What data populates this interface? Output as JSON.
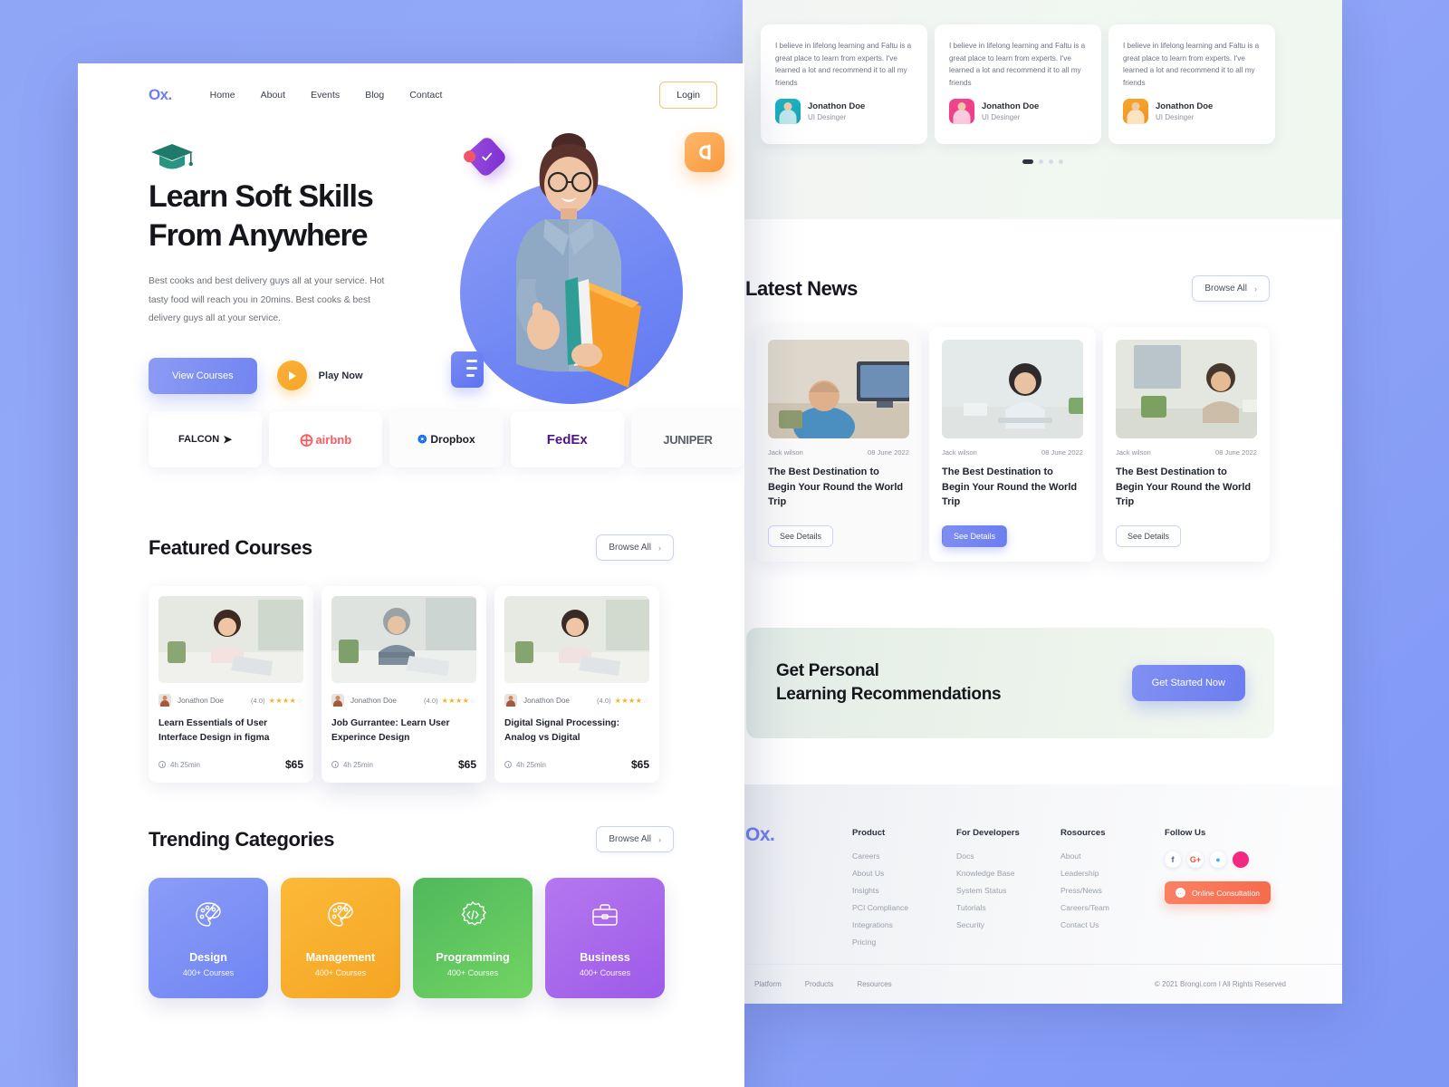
{
  "brand": {
    "logo": "Ox.",
    "accent": "#6d7ef0"
  },
  "nav": {
    "links": [
      "Home",
      "About",
      "Events",
      "Blog",
      "Contact"
    ],
    "login_label": "Login"
  },
  "hero": {
    "title_line1": "Learn Soft Skills",
    "title_line2": "From Anywhere",
    "paragraph": "Best cooks and best delivery guys all at your service. Hot tasty food will reach you in 20mins. Best cooks & best delivery guys all at your service.",
    "primary_btn": "View Courses",
    "play_label": "Play Now"
  },
  "brands": [
    "FALCON",
    "airbnb",
    "Dropbox",
    "FedEx",
    "JUNIPER"
  ],
  "featured": {
    "title": "Featured Courses",
    "browse_label": "Browse All",
    "courses": [
      {
        "author": "Jonathon Doe",
        "rating_text": "(4.0)",
        "stars": 4,
        "title": "Learn Essentials of User Interface Design in figma",
        "duration": "4h 25min",
        "price": "$65"
      },
      {
        "author": "Jonathon Doe",
        "rating_text": "(4.0)",
        "stars": 4,
        "title": "Job Gurrantee: Learn User Experince Design",
        "duration": "4h 25min",
        "price": "$65"
      },
      {
        "author": "Jonathon Doe",
        "rating_text": "(4.0)",
        "stars": 4,
        "title": "Digital Signal Processing: Analog vs Digital",
        "duration": "4h 25min",
        "price": "$65"
      }
    ]
  },
  "trending": {
    "title": "Trending Categories",
    "browse_label": "Browse All",
    "categories": [
      {
        "name": "Design",
        "sub": "400+ Courses",
        "icon": "palette-icon",
        "color": "#7285f1"
      },
      {
        "name": "Management",
        "sub": "400+ Courses",
        "icon": "palette-icon",
        "color": "#f5a524"
      },
      {
        "name": "Programming",
        "sub": "400+ Courses",
        "icon": "gear-code-icon",
        "color": "#5cc35f"
      },
      {
        "name": "Business",
        "sub": "400+ Courses",
        "icon": "briefcase-icon",
        "color": "#9d5ae8"
      }
    ]
  },
  "testimonials": {
    "items": [
      {
        "quote": "I believe in lifelong learning and Faltu is a great place to learn from experts. I've learned a lot and recommend it to all my friends",
        "name": "Jonathon Doe",
        "role": "UI Desinger"
      },
      {
        "quote": "I believe in lifelong learning and Faltu is a great place to learn from experts. I've learned a lot and recommend it to all my friends",
        "name": "Jonathon Doe",
        "role": "UI Desinger"
      },
      {
        "quote": "I believe in lifelong learning and Faltu is a great place to learn from experts. I've learned a lot and recommend it to all my friends",
        "name": "Jonathon Doe",
        "role": "UI Desinger"
      }
    ],
    "dots": 4,
    "active_dot": 0
  },
  "news": {
    "title": "Latest News",
    "browse_label": "Browse All",
    "items": [
      {
        "author": "Jack wilson",
        "date": "08 June 2022",
        "title": "The Best Destination to Begin Your Round the World Trip",
        "btn": "See Details"
      },
      {
        "author": "Jack wilson",
        "date": "08 June 2022",
        "title": "The Best Destination to Begin Your Round the World Trip",
        "btn": "See Details"
      },
      {
        "author": "Jack wilson",
        "date": "08 June 2022",
        "title": "The Best Destination to Begin Your Round the World Trip",
        "btn": "See Details"
      }
    ]
  },
  "cta": {
    "line1": "Get Personal",
    "line2": "Learning Recommendations",
    "button": "Get Started Now"
  },
  "footer": {
    "logo": "Ox.",
    "columns": [
      {
        "title": "Product",
        "links": [
          "Careers",
          "About Us",
          "Insights",
          "PCI Compliance",
          "Integrations",
          "Pricing"
        ]
      },
      {
        "title": "For Developers",
        "links": [
          "Docs",
          "Knowledge Base",
          "System Status",
          "Tutorials",
          "Security"
        ]
      },
      {
        "title": "Rosources",
        "links": [
          "About",
          "Leadership",
          "Press/News",
          "Careers/Team",
          "Contact Us"
        ]
      }
    ],
    "follow_title": "Follow Us",
    "socials": [
      "facebook-icon",
      "google-plus-icon",
      "twitter-icon",
      "dribbble-icon"
    ],
    "consult_label": "Online Consultation",
    "bottom_links": [
      "Platform",
      "Products",
      "Resources"
    ],
    "copyright": "© 2021 Brongi.com I All Rights Reserved"
  }
}
